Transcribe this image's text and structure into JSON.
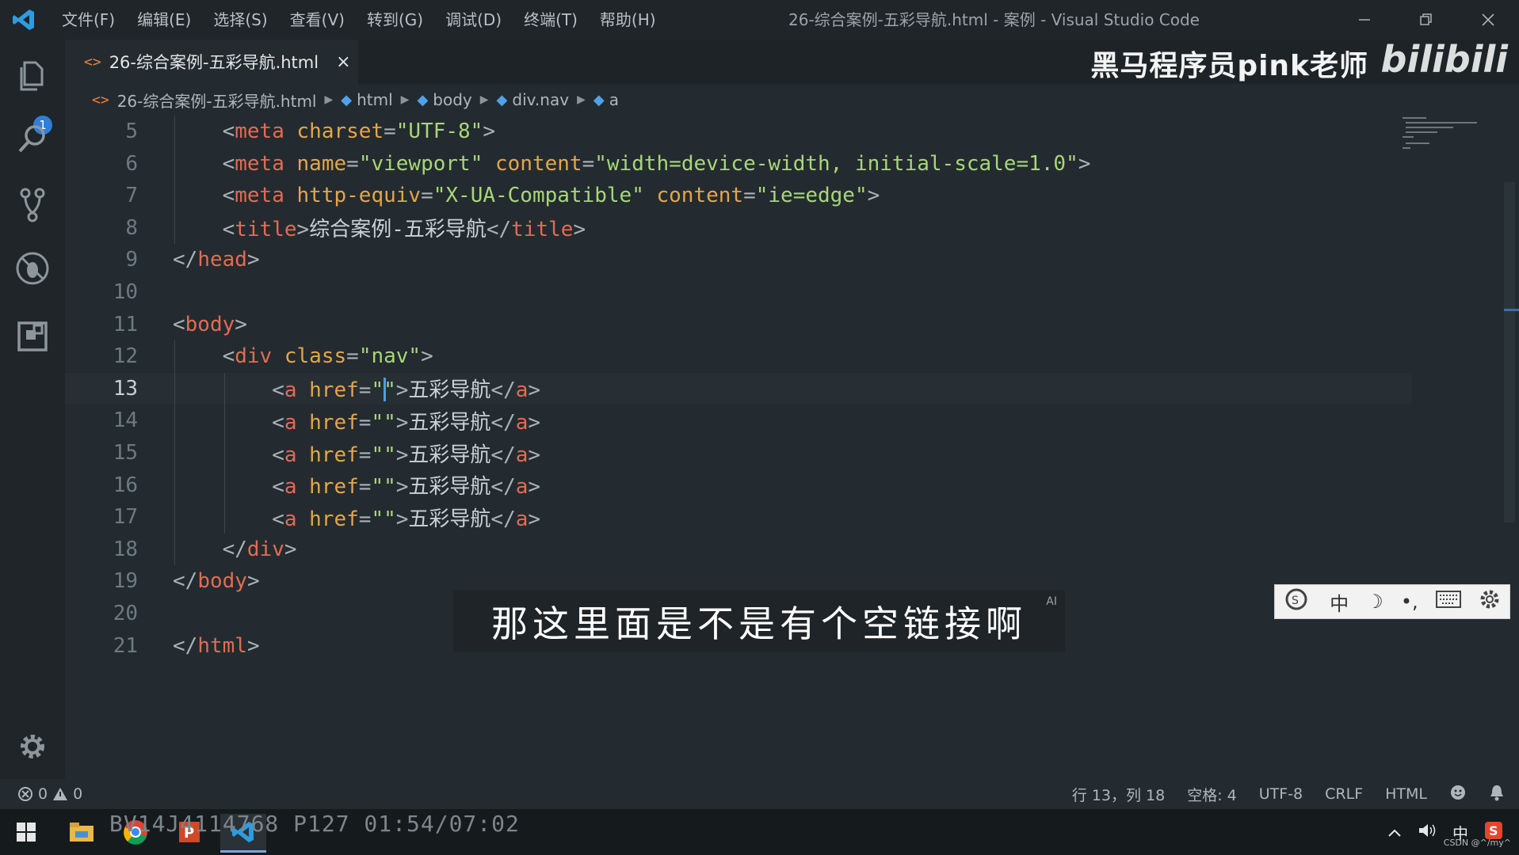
{
  "titlebar": {
    "menus": [
      "文件(F)",
      "编辑(E)",
      "选择(S)",
      "查看(V)",
      "转到(G)",
      "调试(D)",
      "终端(T)",
      "帮助(H)"
    ],
    "window_title": "26-综合案例-五彩导航.html - 案例 - Visual Studio Code",
    "controls": [
      "minimize-icon",
      "restore-icon",
      "close-icon"
    ]
  },
  "activity": {
    "badge": "1",
    "icons": [
      "explorer-icon",
      "search-icon",
      "source-control-icon",
      "debug-icon",
      "extensions-icon",
      "settings-gear-icon"
    ]
  },
  "tab": {
    "label": "26-综合案例-五彩导航.html",
    "icon": "<>",
    "close": "×"
  },
  "watermark": {
    "text": "黑马程序员pink老师",
    "logo": "bilibili"
  },
  "breadcrumb": {
    "file": "26-综合案例-五彩导航.html",
    "items": [
      "html",
      "body",
      "div.nav",
      "a"
    ]
  },
  "editor": {
    "active_line": 13,
    "lines": [
      {
        "n": "5",
        "indent": 2,
        "tokens": [
          [
            "b",
            "<"
          ],
          [
            "t",
            "meta"
          ],
          [
            "x",
            " "
          ],
          [
            "a",
            "charset"
          ],
          [
            "b",
            "="
          ],
          [
            "s",
            "\"UTF-8\""
          ],
          [
            "b",
            ">"
          ]
        ]
      },
      {
        "n": "6",
        "indent": 2,
        "tokens": [
          [
            "b",
            "<"
          ],
          [
            "t",
            "meta"
          ],
          [
            "x",
            " "
          ],
          [
            "a",
            "name"
          ],
          [
            "b",
            "="
          ],
          [
            "s",
            "\"viewport\""
          ],
          [
            "x",
            " "
          ],
          [
            "a",
            "content"
          ],
          [
            "b",
            "="
          ],
          [
            "s",
            "\"width=device-width, initial-scale=1.0\""
          ],
          [
            "b",
            ">"
          ]
        ]
      },
      {
        "n": "7",
        "indent": 2,
        "tokens": [
          [
            "b",
            "<"
          ],
          [
            "t",
            "meta"
          ],
          [
            "x",
            " "
          ],
          [
            "a",
            "http-equiv"
          ],
          [
            "b",
            "="
          ],
          [
            "s",
            "\"X-UA-Compatible\""
          ],
          [
            "x",
            " "
          ],
          [
            "a",
            "content"
          ],
          [
            "b",
            "="
          ],
          [
            "s",
            "\"ie=edge\""
          ],
          [
            "b",
            ">"
          ]
        ]
      },
      {
        "n": "8",
        "indent": 2,
        "tokens": [
          [
            "b",
            "<"
          ],
          [
            "t",
            "title"
          ],
          [
            "b",
            ">"
          ],
          [
            "x",
            "综合案例-五彩导航"
          ],
          [
            "b",
            "</"
          ],
          [
            "t",
            "title"
          ],
          [
            "b",
            ">"
          ]
        ]
      },
      {
        "n": "9",
        "indent": 0,
        "tokens": [
          [
            "b",
            "</"
          ],
          [
            "t",
            "head"
          ],
          [
            "b",
            ">"
          ]
        ]
      },
      {
        "n": "10",
        "indent": 0,
        "tokens": []
      },
      {
        "n": "11",
        "indent": 0,
        "tokens": [
          [
            "b",
            "<"
          ],
          [
            "t",
            "body"
          ],
          [
            "b",
            ">"
          ]
        ]
      },
      {
        "n": "12",
        "indent": 2,
        "tokens": [
          [
            "b",
            "<"
          ],
          [
            "t",
            "div"
          ],
          [
            "x",
            " "
          ],
          [
            "a",
            "class"
          ],
          [
            "b",
            "="
          ],
          [
            "s",
            "\"nav\""
          ],
          [
            "b",
            ">"
          ]
        ]
      },
      {
        "n": "13",
        "indent": 4,
        "tokens": [
          [
            "b",
            "<"
          ],
          [
            "t",
            "a"
          ],
          [
            "x",
            " "
          ],
          [
            "a",
            "href"
          ],
          [
            "b",
            "="
          ],
          [
            "s",
            "\"\""
          ],
          [
            "b",
            ">"
          ],
          [
            "x",
            "五彩导航"
          ],
          [
            "b",
            "</"
          ],
          [
            "t",
            "a"
          ],
          [
            "b",
            ">"
          ]
        ]
      },
      {
        "n": "14",
        "indent": 4,
        "tokens": [
          [
            "b",
            "<"
          ],
          [
            "t",
            "a"
          ],
          [
            "x",
            " "
          ],
          [
            "a",
            "href"
          ],
          [
            "b",
            "="
          ],
          [
            "s",
            "\"\""
          ],
          [
            "b",
            ">"
          ],
          [
            "x",
            "五彩导航"
          ],
          [
            "b",
            "</"
          ],
          [
            "t",
            "a"
          ],
          [
            "b",
            ">"
          ]
        ]
      },
      {
        "n": "15",
        "indent": 4,
        "tokens": [
          [
            "b",
            "<"
          ],
          [
            "t",
            "a"
          ],
          [
            "x",
            " "
          ],
          [
            "a",
            "href"
          ],
          [
            "b",
            "="
          ],
          [
            "s",
            "\"\""
          ],
          [
            "b",
            ">"
          ],
          [
            "x",
            "五彩导航"
          ],
          [
            "b",
            "</"
          ],
          [
            "t",
            "a"
          ],
          [
            "b",
            ">"
          ]
        ]
      },
      {
        "n": "16",
        "indent": 4,
        "tokens": [
          [
            "b",
            "<"
          ],
          [
            "t",
            "a"
          ],
          [
            "x",
            " "
          ],
          [
            "a",
            "href"
          ],
          [
            "b",
            "="
          ],
          [
            "s",
            "\"\""
          ],
          [
            "b",
            ">"
          ],
          [
            "x",
            "五彩导航"
          ],
          [
            "b",
            "</"
          ],
          [
            "t",
            "a"
          ],
          [
            "b",
            ">"
          ]
        ]
      },
      {
        "n": "17",
        "indent": 4,
        "tokens": [
          [
            "b",
            "<"
          ],
          [
            "t",
            "a"
          ],
          [
            "x",
            " "
          ],
          [
            "a",
            "href"
          ],
          [
            "b",
            "="
          ],
          [
            "s",
            "\"\""
          ],
          [
            "b",
            ">"
          ],
          [
            "x",
            "五彩导航"
          ],
          [
            "b",
            "</"
          ],
          [
            "t",
            "a"
          ],
          [
            "b",
            ">"
          ]
        ]
      },
      {
        "n": "18",
        "indent": 2,
        "tokens": [
          [
            "b",
            "</"
          ],
          [
            "t",
            "div"
          ],
          [
            "b",
            ">"
          ]
        ]
      },
      {
        "n": "19",
        "indent": 0,
        "tokens": [
          [
            "b",
            "</"
          ],
          [
            "t",
            "body"
          ],
          [
            "b",
            ">"
          ]
        ]
      },
      {
        "n": "20",
        "indent": 0,
        "tokens": []
      },
      {
        "n": "21",
        "indent": 0,
        "tokens": [
          [
            "b",
            "</"
          ],
          [
            "t",
            "html"
          ],
          [
            "b",
            ">"
          ]
        ]
      }
    ]
  },
  "ime": {
    "items": [
      "ime-logo-icon",
      "中",
      "☽",
      "•,",
      "keyboard-icon",
      "ime-settings-icon"
    ],
    "lang": "中"
  },
  "subtitle": {
    "text": "那这里面是不是有个空链接啊",
    "ai": "AI"
  },
  "statusbar": {
    "errors": "0",
    "warnings": "0",
    "position": "行 13，列 18",
    "spaces": "空格: 4",
    "encoding": "UTF-8",
    "eol": "CRLF",
    "language": "HTML"
  },
  "taskbar": {
    "video_info": "BV14J4114768 P127 01:54/07:02",
    "tray_lang": "中",
    "csdn": "CSDN @^/my^"
  },
  "colors": {
    "tag": "#e36b52",
    "attr": "#e5a54a",
    "string": "#a8d679",
    "bracket": "#a9b2b7",
    "text": "#c9d1d9",
    "accent": "#2f7fd6"
  }
}
